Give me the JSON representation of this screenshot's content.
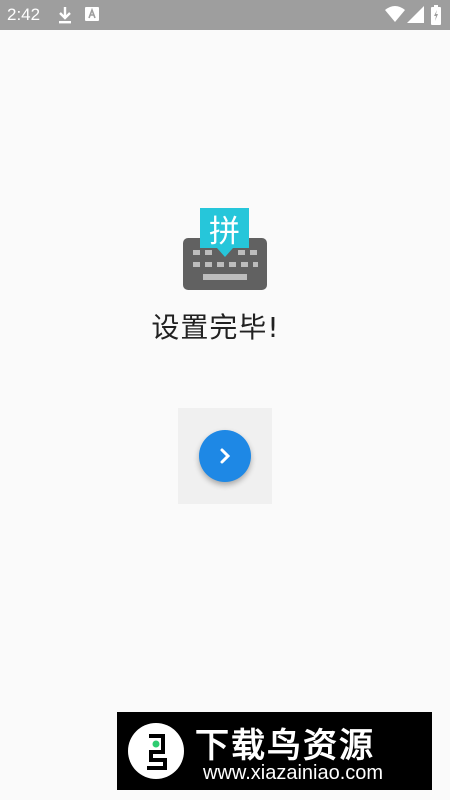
{
  "status_bar": {
    "time": "2:42",
    "icons": [
      "download-icon",
      "notification-icon",
      "wifi-icon",
      "cellular-icon",
      "battery-icon"
    ]
  },
  "illustration": {
    "glyph": "拼",
    "bubble_color": "#26c6da",
    "keyboard_color": "#616161"
  },
  "main": {
    "title": "设置完毕!"
  },
  "next_button": {
    "icon": "chevron-right-icon",
    "color": "#1e88e5"
  },
  "watermark": {
    "title": "下载鸟资源",
    "url": "www.xiazainiao.com"
  }
}
